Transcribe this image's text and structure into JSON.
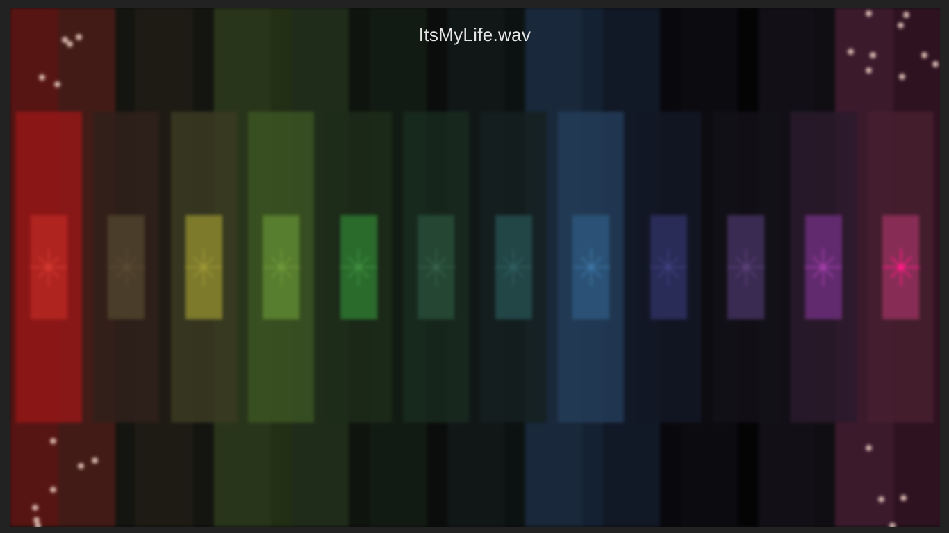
{
  "player": {
    "track_title": "ItsMyLife.wav"
  },
  "background_columns": [
    {
      "color": "#561513"
    },
    {
      "color": "#421b17"
    },
    {
      "color": "#141410"
    },
    {
      "color": "#1e1b14"
    },
    {
      "color": "#141510"
    },
    {
      "color": "#29351a"
    },
    {
      "color": "#232f15"
    },
    {
      "color": "#1f2c1a"
    },
    {
      "color": "#0f140e"
    },
    {
      "color": "#121b13"
    },
    {
      "color": "#0b0d0c"
    },
    {
      "color": "#111717"
    },
    {
      "color": "#0c1211"
    },
    {
      "color": "#19283a"
    },
    {
      "color": "#142132"
    },
    {
      "color": "#111826"
    },
    {
      "color": "#09090d"
    },
    {
      "color": "#0c0b10"
    },
    {
      "color": "#040405"
    },
    {
      "color": "#121016"
    },
    {
      "color": "#100e13"
    },
    {
      "color": "#3b1a2c"
    },
    {
      "color": "#2e1220"
    }
  ],
  "bands": [
    {
      "bar_color": "#941617",
      "inner_color": "#b02420",
      "sparkle_color": "#d2392e",
      "level": 1.0
    },
    {
      "bar_color": "#30201a",
      "inner_color": "#4a3d29",
      "sparkle_color": "#5a4a34",
      "level": 1.0
    },
    {
      "bar_color": "#3a3a22",
      "inner_color": "#7d7a2c",
      "sparkle_color": "#9a9634",
      "level": 1.0
    },
    {
      "bar_color": "#3b5423",
      "inner_color": "#577d2e",
      "sparkle_color": "#6f993a",
      "level": 1.0
    },
    {
      "bar_color": "#1d2c1a",
      "inner_color": "#2a6b2c",
      "sparkle_color": "#3f8c3f",
      "level": 1.0
    },
    {
      "bar_color": "#192a20",
      "inner_color": "#244632",
      "sparkle_color": "#356048",
      "level": 1.0
    },
    {
      "bar_color": "#152020",
      "inner_color": "#224546",
      "sparkle_color": "#2f5e60",
      "level": 1.0
    },
    {
      "bar_color": "#233c58",
      "inner_color": "#2b5276",
      "sparkle_color": "#3c73a3",
      "level": 1.0
    },
    {
      "bar_color": "#131826",
      "inner_color": "#292c57",
      "sparkle_color": "#3d3f7c",
      "level": 1.0
    },
    {
      "bar_color": "#141219",
      "inner_color": "#3a2b52",
      "sparkle_color": "#5a3f78",
      "level": 1.0
    },
    {
      "bar_color": "#2a1a2c",
      "inner_color": "#622a6e",
      "sparkle_color": "#a03ea7",
      "level": 1.0
    },
    {
      "bar_color": "#46202f",
      "inner_color": "#872d55",
      "sparkle_color": "#ff1b86",
      "level": 1.0
    }
  ],
  "particles_count_visible": 25
}
